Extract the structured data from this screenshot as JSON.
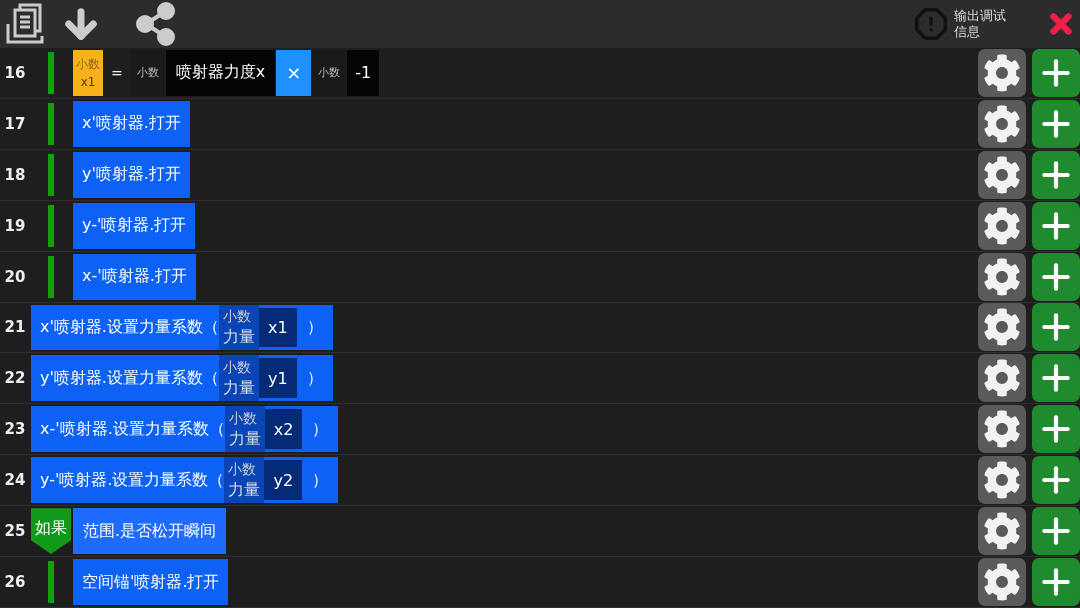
{
  "toolbar": {
    "debug_label": "输出调试信息"
  },
  "rows": [
    {
      "kind": "assign",
      "line": "16",
      "indented": true,
      "target_type": "小数",
      "target_name": "x1",
      "assign_op": "=",
      "left": {
        "type": "小数",
        "value": "喷射器力度x"
      },
      "operator": "×",
      "right": {
        "type": "小数",
        "value": "-1"
      }
    },
    {
      "kind": "call",
      "line": "17",
      "indented": true,
      "text": "x'喷射器.打开"
    },
    {
      "kind": "call",
      "line": "18",
      "indented": true,
      "text": "y'喷射器.打开"
    },
    {
      "kind": "call",
      "line": "19",
      "indented": true,
      "text": "y-'喷射器.打开"
    },
    {
      "kind": "call",
      "line": "20",
      "indented": true,
      "text": "x-'喷射器.打开"
    },
    {
      "kind": "call_param",
      "line": "21",
      "indented": false,
      "text": "x'喷射器.设置力量系数（",
      "param_type": "小数",
      "param_name": "力量",
      "value": "x1",
      "close": "）"
    },
    {
      "kind": "call_param",
      "line": "22",
      "indented": false,
      "text": "y'喷射器.设置力量系数（",
      "param_type": "小数",
      "param_name": "力量",
      "value": "y1",
      "close": "）"
    },
    {
      "kind": "call_param",
      "line": "23",
      "indented": false,
      "text": "x-'喷射器.设置力量系数（",
      "param_type": "小数",
      "param_name": "力量",
      "value": "x2",
      "close": "）"
    },
    {
      "kind": "call_param",
      "line": "24",
      "indented": false,
      "text": "y-'喷射器.设置力量系数（",
      "param_type": "小数",
      "param_name": "力量",
      "value": "y2",
      "close": "）"
    },
    {
      "kind": "if",
      "line": "25",
      "indented": false,
      "keyword": "如果",
      "condition": "范围.是否松开瞬间"
    },
    {
      "kind": "call",
      "line": "26",
      "indented": true,
      "text": "空间锚'喷射器.打开"
    }
  ]
}
